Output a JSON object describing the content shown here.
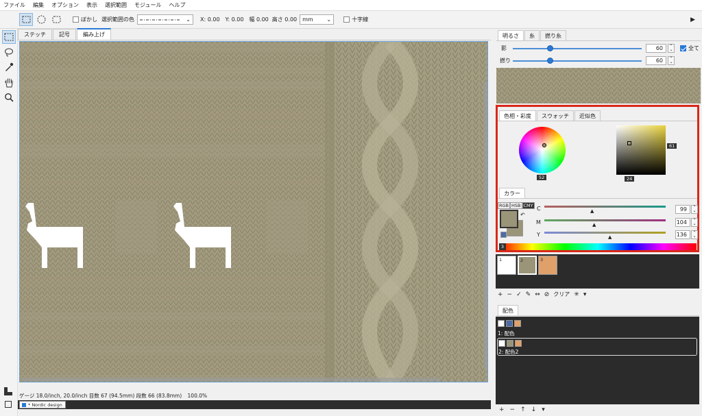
{
  "menu": [
    "ファイル",
    "編集",
    "オプション",
    "表示",
    "選択範囲",
    "モジュール",
    "ヘルプ"
  ],
  "toolbar": {
    "blur_label": "ぼかし",
    "selection_color_label": "選択範囲の色",
    "x": "X: 0.00",
    "y": "Y: 0.00",
    "width": "幅 0.00",
    "height": "高さ 0.00",
    "unit": "mm",
    "crosshair_label": "十字線"
  },
  "doc_tabs": [
    "ステッチ",
    "記号",
    "編み上げ"
  ],
  "status": {
    "gauge": "ゲージ 18.0/inch, 20.0/inch",
    "stitches": "目数 67 (94.5mm)",
    "rows": "段数 66 (83.8mm)",
    "zoom": "100.0%"
  },
  "task_item": "* Nordic design",
  "right": {
    "top_tabs": [
      "明るさ",
      "糸",
      "撚り糸"
    ],
    "shadow_label": "影",
    "shadow_value": "60",
    "all_label": "全て",
    "twist_label": "撚り",
    "twist_value": "60",
    "color_tabs": [
      "色相・彩度",
      "スウォッチ",
      "近似色"
    ],
    "hue_value": "52",
    "sat_value": "61",
    "bright_value": "24",
    "color_tab": "カラー",
    "modes": [
      "RGB",
      "HSB",
      "CMY"
    ],
    "channels": [
      {
        "name": "C",
        "value": "99"
      },
      {
        "name": "M",
        "value": "104"
      },
      {
        "name": "Y",
        "value": "136"
      }
    ],
    "spectrum_index": "3",
    "swatches": [
      {
        "n": "1",
        "color": "#ffffff"
      },
      {
        "n": "2",
        "color": "#9a9479"
      },
      {
        "n": "3",
        "color": "#e0a06a"
      }
    ],
    "swatch_clear": "クリア",
    "scheme_tab": "配色",
    "schemes": [
      {
        "label": "1: 配色",
        "colors": [
          "#ffffff",
          "#4c6aa6",
          "#e0a06a"
        ]
      },
      {
        "label": "2: 配色2",
        "colors": [
          "#ffffff",
          "#9a9479",
          "#e0a06a"
        ]
      }
    ]
  }
}
